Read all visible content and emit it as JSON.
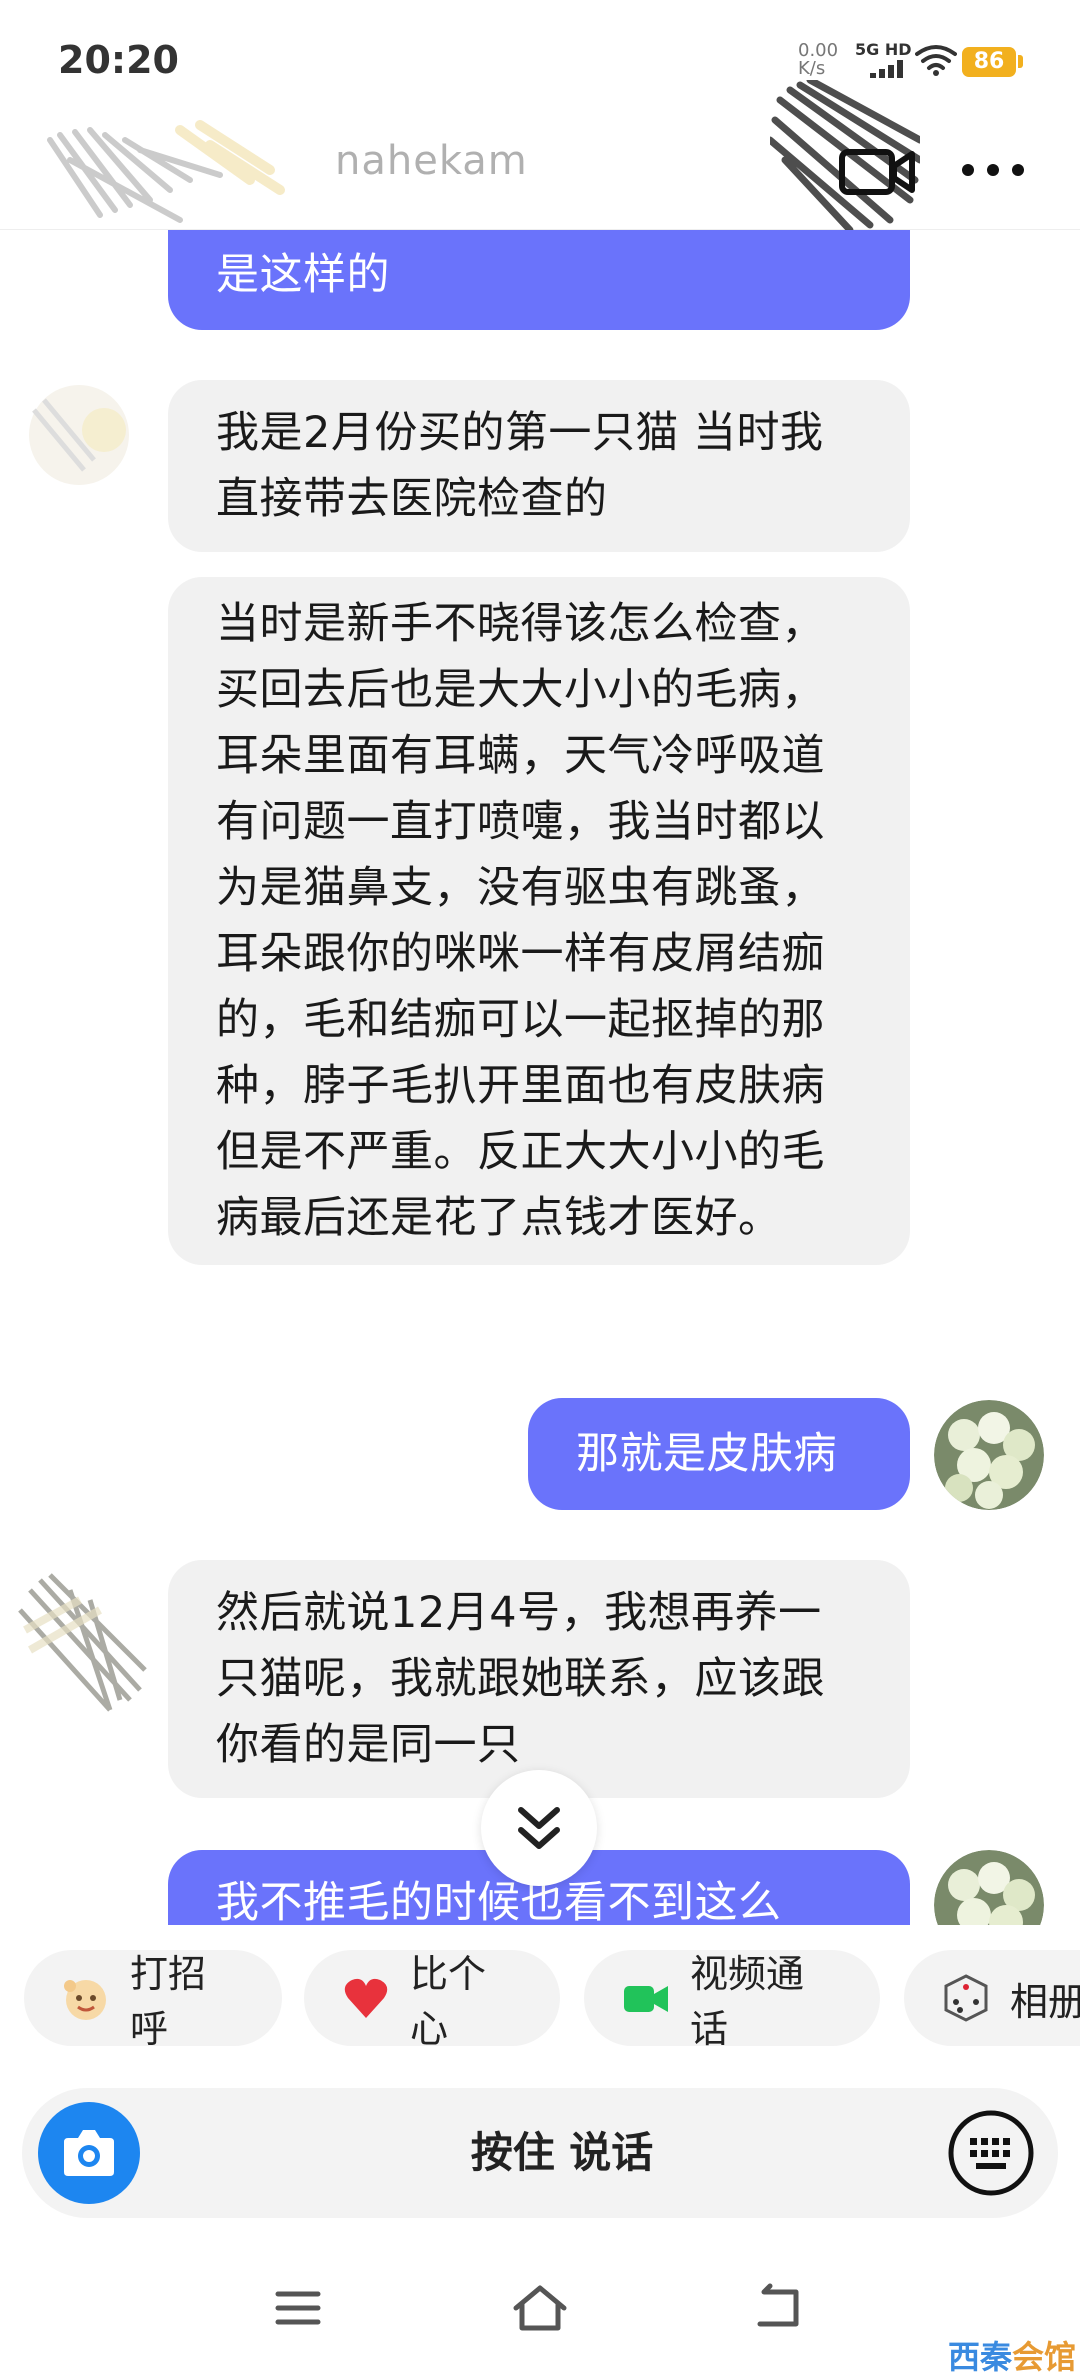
{
  "status_bar": {
    "time": "20:20",
    "speed_value": "0.00",
    "speed_unit": "K/s",
    "network": "5G HD",
    "battery": "86"
  },
  "header": {
    "contact_name": "nahekam"
  },
  "messages": [
    {
      "side": "out",
      "text": "是这样的"
    },
    {
      "side": "in",
      "text": "我是2月份买的第一只猫 当时我直接带去医院检查的"
    },
    {
      "side": "in",
      "text": "当时是新手不晓得该怎么检查，买回去后也是大大小小的毛病，耳朵里面有耳螨，天气冷呼吸道有问题一直打喷嚏，我当时都以为是猫鼻支，没有驱虫有跳蚤，耳朵跟你的咪咪一样有皮屑结痂的，毛和结痂可以一起抠掉的那种，脖子毛扒开里面也有皮肤病但是不严重。反正大大小小的毛病最后还是花了点钱才医好。"
    },
    {
      "side": "out",
      "text": "那就是皮肤病"
    },
    {
      "side": "in",
      "text": "然后就说12月4号，我想再养一只猫呢，我就跟她联系，应该跟你看的是同一只"
    },
    {
      "side": "out",
      "text": "我不推毛的时候也看不到这么"
    }
  ],
  "quick_actions": [
    {
      "label": "打招呼",
      "icon": "wave-emoji-icon"
    },
    {
      "label": "比个心",
      "icon": "heart-icon"
    },
    {
      "label": "视频通话",
      "icon": "video-camera-icon"
    },
    {
      "label": "相册",
      "icon": "dice-icon"
    }
  ],
  "input": {
    "hold_to_talk": "按住 说话"
  },
  "watermark": {
    "part1": "西秦",
    "part2": "会馆"
  },
  "colors": {
    "outgoing_bubble": "#6a73fb",
    "incoming_bubble": "#f1f1f1",
    "camera_button": "#1d86f0",
    "battery": "#f2b01e"
  }
}
